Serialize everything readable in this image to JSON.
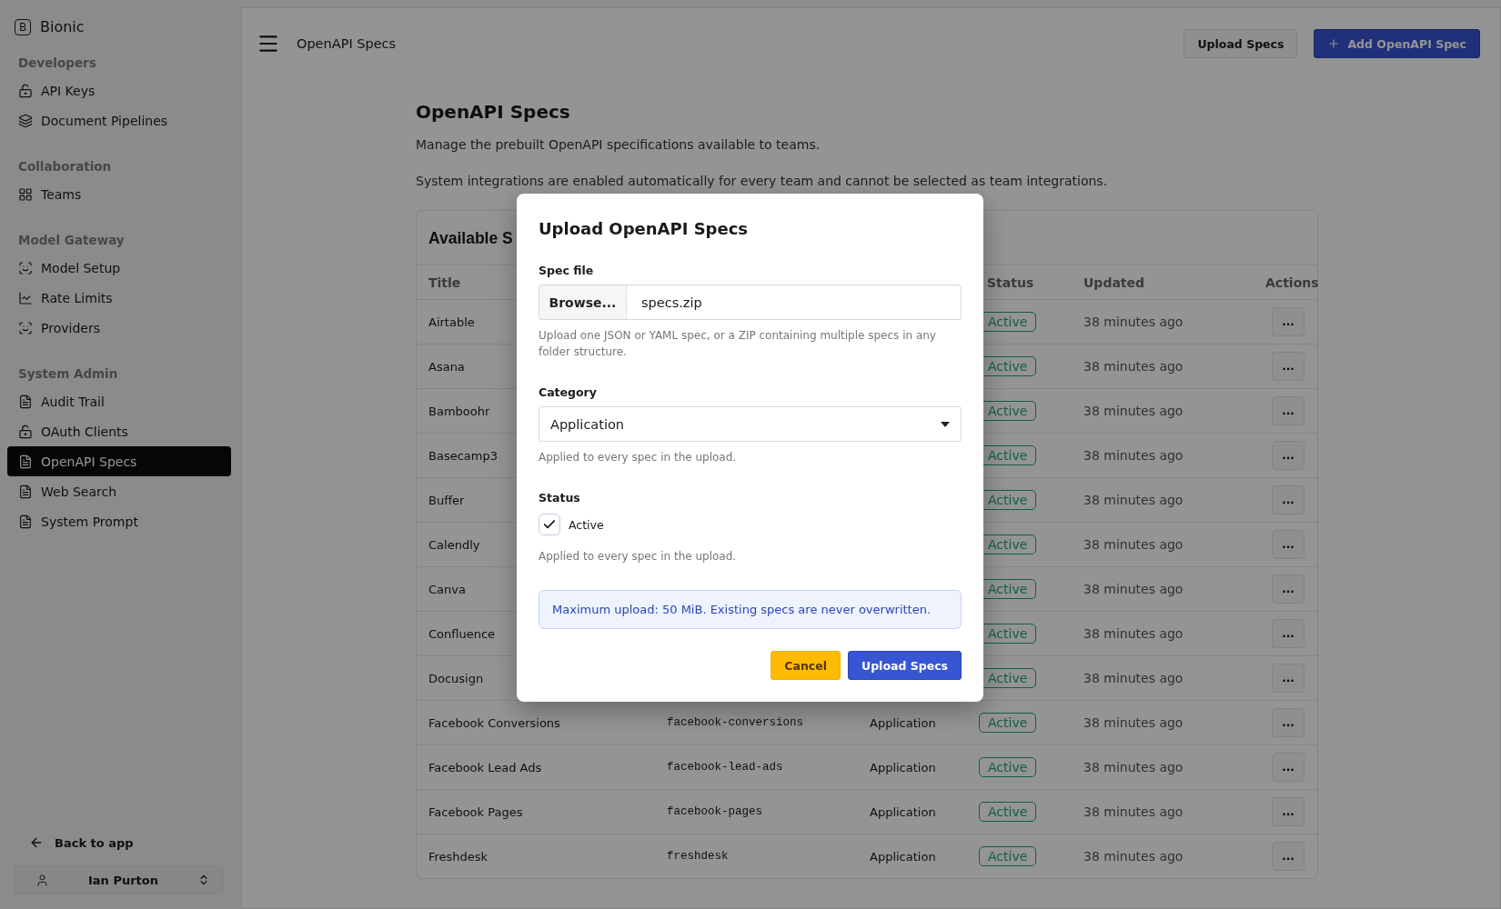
{
  "sidebar": {
    "brand": {
      "letter": "B",
      "name": "Bionic"
    },
    "sections": [
      {
        "title": "Developers",
        "items": [
          {
            "label": "API Keys",
            "selected": false
          },
          {
            "label": "Document Pipelines",
            "selected": false
          }
        ]
      },
      {
        "title": "Collaboration",
        "items": [
          {
            "label": "Teams",
            "selected": false
          }
        ]
      },
      {
        "title": "Model Gateway",
        "items": [
          {
            "label": "Model Setup",
            "selected": false
          },
          {
            "label": "Rate Limits",
            "selected": false
          },
          {
            "label": "Providers",
            "selected": false
          }
        ]
      },
      {
        "title": "System Admin",
        "items": [
          {
            "label": "Audit Trail",
            "selected": false
          },
          {
            "label": "OAuth Clients",
            "selected": false
          },
          {
            "label": "OpenAPI Specs",
            "selected": true
          },
          {
            "label": "Web Search",
            "selected": false
          },
          {
            "label": "System Prompt",
            "selected": false
          }
        ]
      }
    ],
    "back_link": "Back to app",
    "user": {
      "name": "Ian Purton"
    }
  },
  "topbar": {
    "title": "OpenAPI Specs",
    "buttons": [
      "Upload Specs",
      "Add OpenAPI Spec"
    ]
  },
  "page": {
    "heading": "OpenAPI Specs",
    "description": "Manage the prebuilt OpenAPI specifications available to teams.",
    "note": "System integrations are enabled automatically for every team and cannot be selected as team integrations."
  },
  "table": {
    "title": "Available S",
    "columns": {
      "title": "Title",
      "status": "Status",
      "updated": "Updated",
      "actions": "Actions"
    },
    "rows": [
      {
        "title": "Airtable",
        "status": "Active",
        "updated": "38 minutes ago",
        "action": "..."
      },
      {
        "title": "Asana",
        "status": "Active",
        "updated": "38 minutes ago",
        "action": "..."
      },
      {
        "title": "Bamboohr",
        "status": "Active",
        "updated": "38 minutes ago",
        "action": "..."
      },
      {
        "title": "Basecamp3",
        "status": "Active",
        "updated": "38 minutes ago",
        "action": "..."
      },
      {
        "title": "Buffer",
        "status": "Active",
        "updated": "38 minutes ago",
        "action": "..."
      },
      {
        "title": "Calendly",
        "status": "Active",
        "updated": "38 minutes ago",
        "action": "..."
      },
      {
        "title": "Canva",
        "status": "Active",
        "updated": "38 minutes ago",
        "action": "..."
      },
      {
        "title": "Confluence",
        "status": "Active",
        "updated": "38 minutes ago",
        "action": "..."
      },
      {
        "title": "Docusign",
        "status": "Active",
        "updated": "38 minutes ago",
        "action": "..."
      },
      {
        "title": "Facebook Conversions",
        "slug": "facebook-conversions",
        "category": "Application",
        "status": "Active",
        "updated": "38 minutes ago",
        "action": "..."
      },
      {
        "title": "Facebook Lead Ads",
        "slug": "facebook-lead-ads",
        "category": "Application",
        "status": "Active",
        "updated": "38 minutes ago",
        "action": "..."
      },
      {
        "title": "Facebook Pages",
        "slug": "facebook-pages",
        "category": "Application",
        "status": "Active",
        "updated": "38 minutes ago",
        "action": "..."
      },
      {
        "title": "Freshdesk",
        "slug": "freshdesk",
        "category": "Application",
        "status": "Active",
        "updated": "38 minutes ago",
        "action": "..."
      }
    ]
  },
  "modal": {
    "title": "Upload OpenAPI Specs",
    "spec_file": {
      "label": "Spec file",
      "browse": "Browse...",
      "value": "specs.zip",
      "hint": "Upload one JSON or YAML spec, or a ZIP containing multiple specs in any folder structure."
    },
    "category": {
      "label": "Category",
      "value": "Application",
      "hint": "Applied to every spec in the upload."
    },
    "status": {
      "label": "Status",
      "checkbox": {
        "label": "Active",
        "checked": true
      },
      "hint": "Applied to every spec in the upload."
    },
    "alert": "Maximum upload: 50 MiB. Existing specs are never overwritten.",
    "buttons": {
      "cancel": "Cancel",
      "submit": "Upload Specs"
    }
  }
}
